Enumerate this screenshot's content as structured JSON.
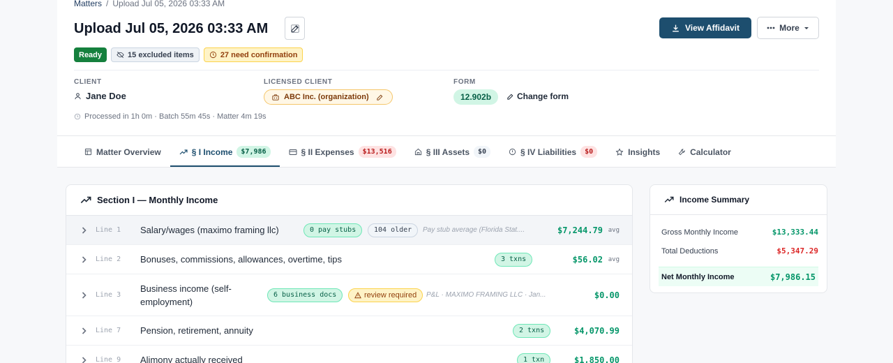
{
  "breadcrumb": {
    "root": "Matters",
    "separator": "/",
    "current": "Upload Jul 05, 2026 03:33 AM"
  },
  "title": "Upload Jul 05, 2026 03:33 AM",
  "actions": {
    "view_affidavit": "View Affidavit",
    "more": "More"
  },
  "badges": {
    "status": "Ready",
    "excluded": "15 excluded items",
    "confirmation": "27 need confirmation"
  },
  "client": {
    "label": "CLIENT",
    "name": "Jane Doe"
  },
  "licensed_client": {
    "label": "LICENSED CLIENT",
    "value": "ABC Inc. (organization)"
  },
  "form": {
    "label": "FORM",
    "value": "12.902b",
    "change": "Change form"
  },
  "processed": "Processed in 1h 0m · Batch 55m 45s · Matter 4m 19s",
  "tabs": [
    {
      "label": "Matter Overview",
      "icon": "overview-icon"
    },
    {
      "label": "§ I Income",
      "badge": "$7,986",
      "icon": "trend-icon"
    },
    {
      "label": "§ II Expenses",
      "badge": "$13,516",
      "icon": "card-icon"
    },
    {
      "label": "§ III Assets",
      "badge": "$0",
      "icon": "home-icon"
    },
    {
      "label": "§ IV Liabilities",
      "badge": "$0",
      "icon": "alert-icon"
    },
    {
      "label": "Insights",
      "icon": "star-icon"
    },
    {
      "label": "Calculator",
      "icon": "wrench-icon"
    }
  ],
  "income": {
    "title": "Section I — Monthly Income",
    "rows": [
      {
        "line": "Line 1",
        "desc": "Salary/wages (maximo framing llc)",
        "chips": [
          "0 pay stubs",
          "104 older"
        ],
        "note": "Pay stub average (Florida Stat....",
        "amount": "$7,244.79",
        "suffix": "avg"
      },
      {
        "line": "Line 2",
        "desc": "Bonuses, commissions, allowances, overtime, tips",
        "chips": [
          "3 txns"
        ],
        "amount": "$56.02",
        "suffix": "avg"
      },
      {
        "line": "Line 3",
        "desc": "Business income (self-employment)",
        "chips": [
          "6 business docs",
          "review required"
        ],
        "note": "P&L · MAXIMO FRAMING LLC · Jan...",
        "amount": "$0.00"
      },
      {
        "line": "Line 7",
        "desc": "Pension, retirement, annuity",
        "chips": [
          "2 txns"
        ],
        "amount": "$4,070.99"
      },
      {
        "line": "Line 9",
        "desc": "Alimony actually received",
        "chips": [
          "1 txn"
        ],
        "amount": "$1,850.00"
      }
    ]
  },
  "summary": {
    "title": "Income Summary",
    "gross_label": "Gross Monthly Income",
    "gross": "$13,333.44",
    "deductions_label": "Total Deductions",
    "deductions": "$5,347.29",
    "net_label": "Net Monthly Income",
    "net": "$7,986.15"
  },
  "colors": {
    "primary": "#1d4e6e",
    "positive": "#059669",
    "negative": "#dc2626",
    "ready": "#15803d"
  }
}
